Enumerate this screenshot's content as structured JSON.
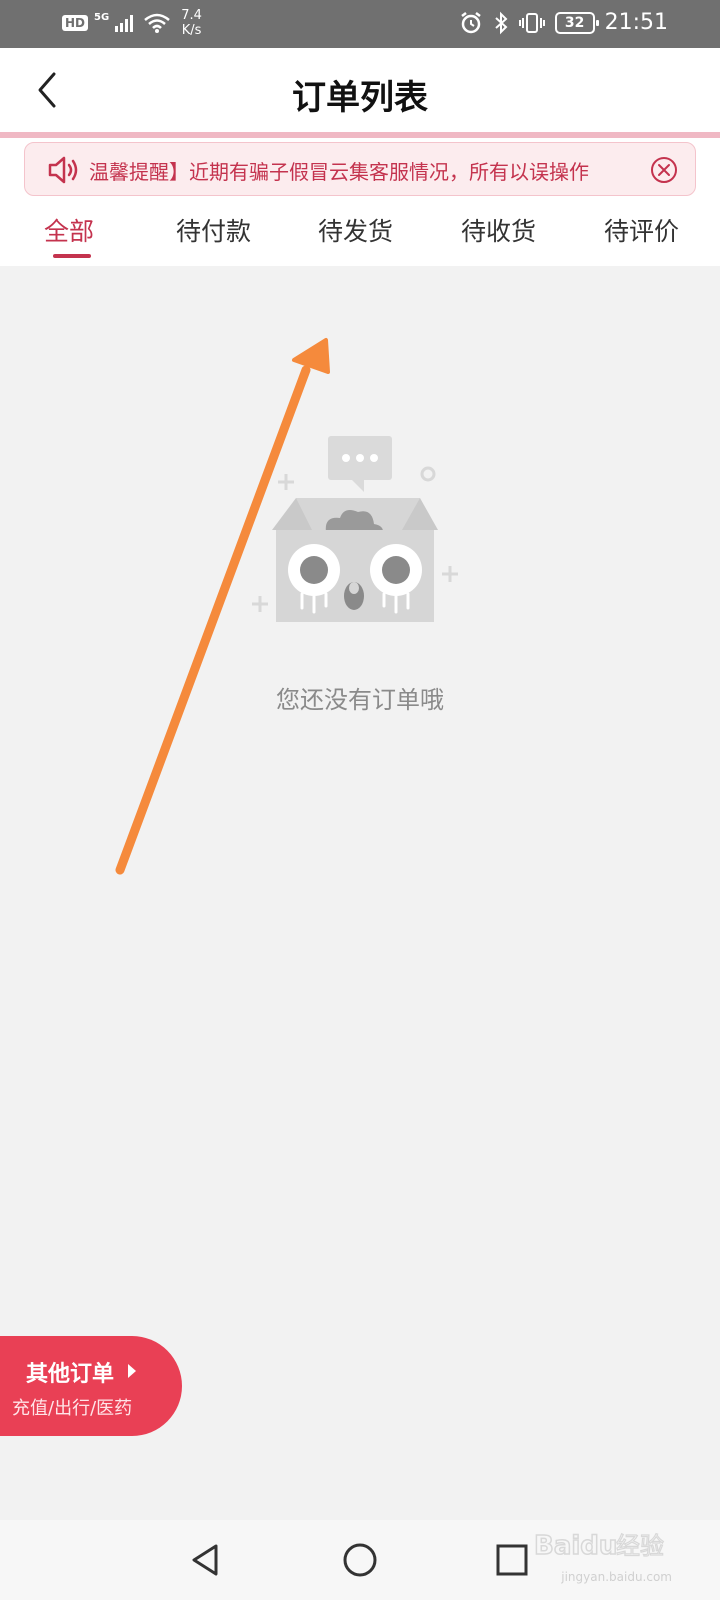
{
  "status_bar": {
    "hd": "HD",
    "network": "5G",
    "speed_value": "7.4",
    "speed_unit": "K/s",
    "battery": "32",
    "time": "21:51"
  },
  "header": {
    "title": "订单列表"
  },
  "notice": {
    "text": "温馨提醒】近期有骗子假冒云集客服情况，所有以误操作"
  },
  "tabs": [
    {
      "label": "全部",
      "active": true
    },
    {
      "label": "待付款",
      "active": false
    },
    {
      "label": "待发货",
      "active": false
    },
    {
      "label": "待收货",
      "active": false
    },
    {
      "label": "待评价",
      "active": false
    }
  ],
  "empty_state": {
    "message": "您还没有订单哦"
  },
  "other_orders": {
    "title": "其他订单",
    "subtitle": "充值/出行/医药"
  },
  "watermark": {
    "logo": "Baidu经验",
    "url": "jingyan.baidu.com"
  },
  "colors": {
    "accent": "#c4334e",
    "floating_button": "#e94055",
    "annotation_arrow": "#f58a3c"
  }
}
